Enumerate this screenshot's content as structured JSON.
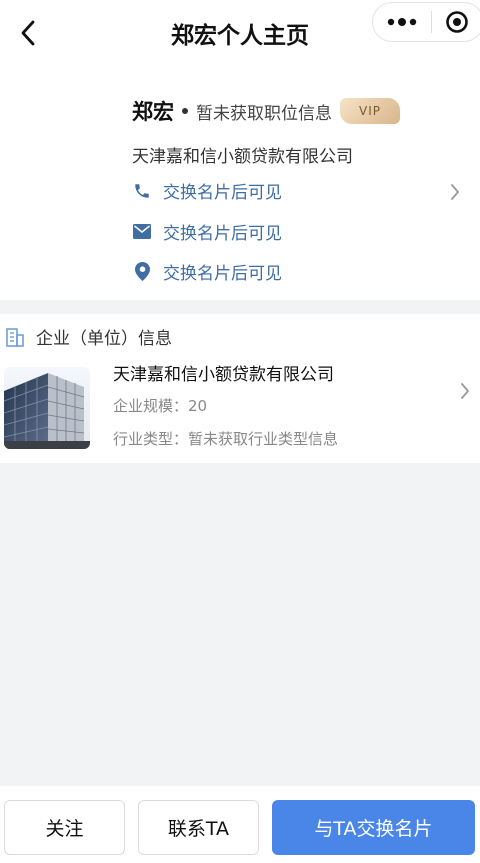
{
  "nav": {
    "title": "郑宏个人主页",
    "back_icon": "chevron-left-icon",
    "more_icon": "more-dots-icon",
    "close_icon": "miniprogram-close-icon"
  },
  "profile": {
    "name": "郑宏",
    "position": "暂未获取职位信息",
    "vip_badge": "VIP",
    "company": "天津嘉和信小额贷款有限公司",
    "contacts": [
      {
        "icon": "phone-icon",
        "text": "交换名片后可见"
      },
      {
        "icon": "mail-icon",
        "text": "交换名片后可见"
      },
      {
        "icon": "location-icon",
        "text": "交换名片后可见"
      }
    ]
  },
  "enterprise": {
    "section_title": "企业（单位）信息",
    "name": "天津嘉和信小额贷款有限公司",
    "scale": "企业规模：20",
    "industry": "行业类型：暂未获取行业类型信息"
  },
  "actions": {
    "follow": "关注",
    "contact": "联系TA",
    "exchange": "与TA交换名片"
  },
  "colors": {
    "accent": "#4a86e8",
    "link_blue": "#3f6da4",
    "vip_gold": "#d9b58a"
  }
}
